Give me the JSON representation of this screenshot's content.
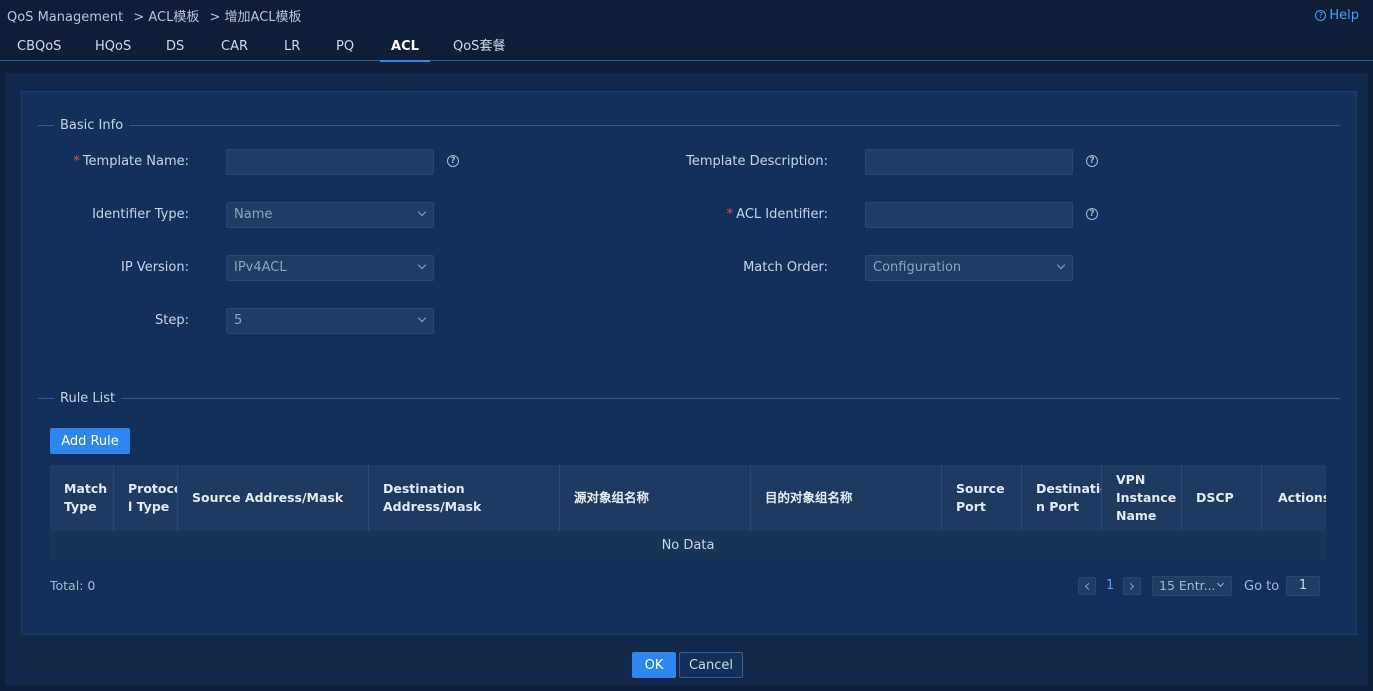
{
  "breadcrumb": [
    "QoS Management",
    "> ACL模板",
    "> 增加ACL模板"
  ],
  "help_label": "Help",
  "tabs": [
    "CBQoS",
    "HQoS",
    "DS",
    "CAR",
    "LR",
    "PQ",
    "ACL",
    "QoS套餐"
  ],
  "active_tab": "ACL",
  "basic_info": {
    "title": "Basic Info",
    "template_name_label": "Template Name:",
    "template_name_value": "",
    "template_description_label": "Template Description:",
    "template_description_value": "",
    "identifier_type_label": "Identifier Type:",
    "identifier_type_value": "Name",
    "acl_identifier_label": "ACL Identifier:",
    "acl_identifier_value": "",
    "ip_version_label": "IP Version:",
    "ip_version_value": "IPv4ACL",
    "match_order_label": "Match Order:",
    "match_order_value": "Configuration",
    "step_label": "Step:",
    "step_value": "5",
    "help_glyph": "?"
  },
  "rule_list": {
    "title": "Rule List",
    "add_rule_label": "Add Rule",
    "columns": [
      "Match Type",
      "Protocol Type",
      "Source Address/Mask",
      "Destination Address/Mask",
      "源对象组名称",
      "目的对象组名称",
      "Source Port",
      "Destination Port",
      "VPN Instance Name",
      "DSCP",
      "Actions"
    ],
    "column_display": [
      "Match\nType",
      "Protoco\nl Type",
      "Source Address/Mask",
      "Destination Address/Mask",
      "源对象组名称",
      "目的对象组名称",
      "Source\nPort",
      "Destinatio\nn Port",
      "VPN\nInstance\nName",
      "DSCP",
      "Actions"
    ],
    "no_data": "No Data",
    "total": "Total: 0",
    "current_page": "1",
    "page_size": "15 Entr...",
    "goto_label": "Go to",
    "goto_value": "1"
  },
  "footer": {
    "ok_label": "OK",
    "cancel_label": "Cancel"
  },
  "colors": {
    "accent": "#2e86f0",
    "required": "#f04848",
    "background": "#0e1f38"
  }
}
